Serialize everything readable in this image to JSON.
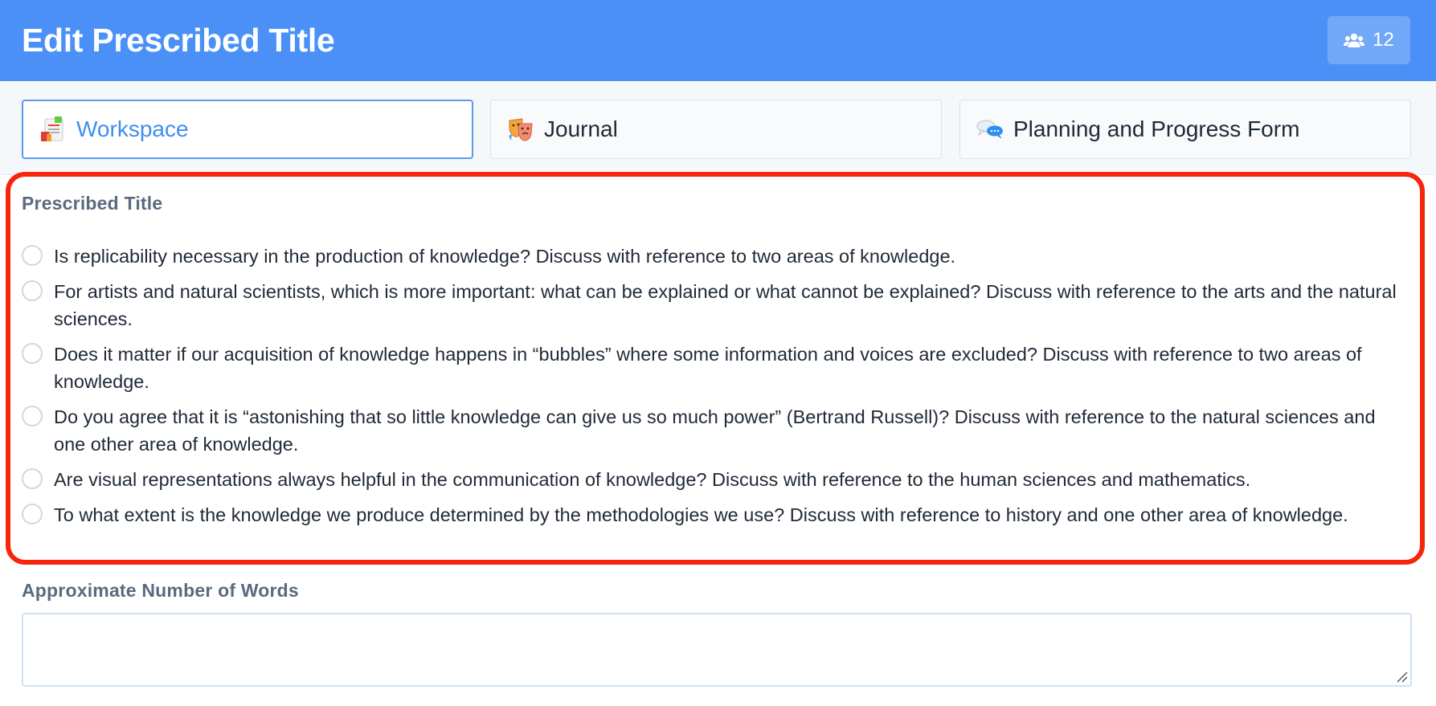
{
  "header": {
    "title": "Edit Prescribed Title",
    "user_count": "12",
    "users_icon": "users-icon"
  },
  "tabs": [
    {
      "label": "Workspace",
      "icon": "notepad-icon",
      "active": true
    },
    {
      "label": "Journal",
      "icon": "theater-masks-icon",
      "active": false
    },
    {
      "label": "Planning and Progress Form",
      "icon": "speech-bubbles-icon",
      "active": false
    }
  ],
  "prescribed_title": {
    "label": "Prescribed Title",
    "options": [
      "Is replicability necessary in the production of knowledge? Discuss with reference to two areas of knowledge.",
      "For artists and natural scientists, which is more important: what can be explained or what cannot be explained? Discuss with reference to the arts and the natural sciences.",
      "Does it matter if our acquisition of knowledge happens in “bubbles” where some information and voices are excluded? Discuss with reference to two areas of knowledge.",
      "Do you agree that it is “astonishing that so little knowledge can give us so much power” (Bertrand Russell)? Discuss with reference to the natural sciences and one other area of knowledge.",
      "Are visual representations always helpful in the communication of knowledge? Discuss with reference to the human sciences and mathematics.",
      "To what extent is the knowledge we produce determined by the methodologies we use? Discuss with reference to history and one other area of knowledge."
    ]
  },
  "word_count": {
    "label": "Approximate Number of Words",
    "value": ""
  },
  "colors": {
    "header_bg": "#4a90f7",
    "accent": "#3d8ef0",
    "highlight": "#f6250b"
  }
}
